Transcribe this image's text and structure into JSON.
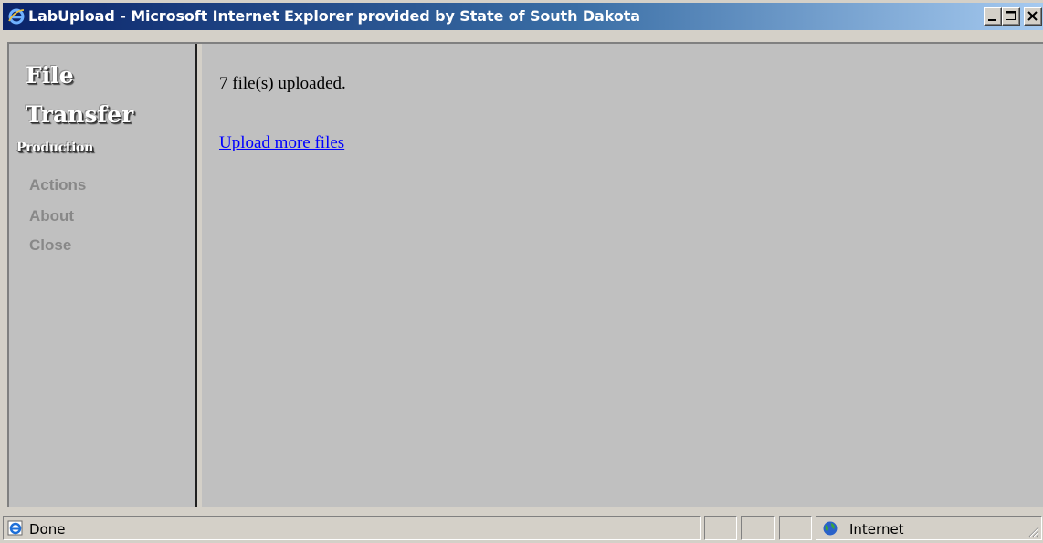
{
  "window": {
    "title": "LabUpload - Microsoft Internet Explorer provided by State of South Dakota",
    "controls": {
      "minimize": "minimize",
      "maximize": "maximize",
      "close": "close"
    }
  },
  "sidebar": {
    "logo_line1": "File",
    "logo_line2": "Transfer",
    "environment": "Production",
    "nav": [
      {
        "label": "Actions"
      },
      {
        "label": "About"
      },
      {
        "label": "Close"
      }
    ]
  },
  "content": {
    "message": "7 file(s) uploaded.",
    "link": "Upload more files"
  },
  "statusbar": {
    "status": "Done",
    "zone": "Internet"
  },
  "colors": {
    "titlebar_start": "#0a246a",
    "titlebar_end": "#a6caf0",
    "page_background": "#c0c0c0",
    "link": "#0000ff",
    "nav_text": "#888888"
  }
}
